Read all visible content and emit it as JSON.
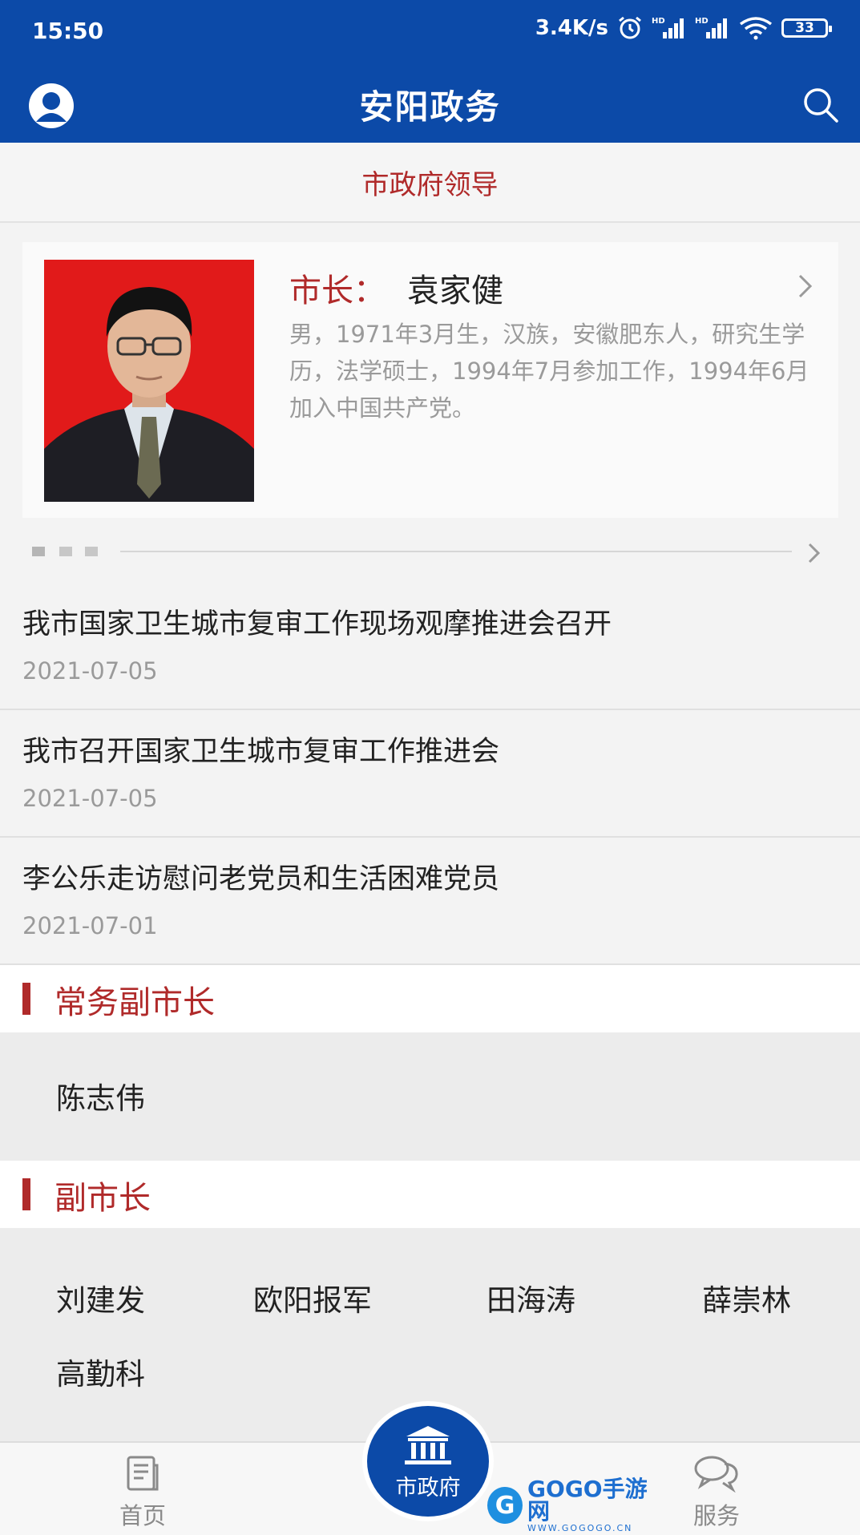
{
  "status_bar": {
    "time": "15:50",
    "network_speed": "3.4K/s",
    "battery": "33",
    "icons": [
      "alarm-icon",
      "signal-hd-icon",
      "signal-hd-icon",
      "wifi-icon",
      "battery-icon"
    ]
  },
  "header": {
    "title": "安阳政务",
    "avatar_icon": "user-avatar-icon",
    "search_icon": "search-icon",
    "accent_color": "#0c4aa8"
  },
  "section": {
    "title": "市政府领导"
  },
  "leader_card": {
    "role": "市长：",
    "name": "袁家健",
    "bio": "男，1971年3月生，汉族，安徽肥东人，研究生学历，法学硕士，1994年7月参加工作，1994年6月加入中国共产党。"
  },
  "news": [
    {
      "title": "我市国家卫生城市复审工作现场观摩推进会召开",
      "date": "2021-07-05"
    },
    {
      "title": "我市召开国家卫生城市复审工作推进会",
      "date": "2021-07-05"
    },
    {
      "title": "李公乐走访慰问老党员和生活困难党员",
      "date": "2021-07-01"
    }
  ],
  "categories": [
    {
      "label": "常务副市长",
      "people": [
        "陈志伟"
      ]
    },
    {
      "label": "副市长",
      "people": [
        "刘建发",
        "欧阳报军",
        "田海涛",
        "薛崇林",
        "高勤科"
      ]
    }
  ],
  "tabbar": {
    "home": "首页",
    "center": "市政府",
    "service": "服务"
  },
  "watermark": {
    "brand": "GOGO手游网",
    "sub": "WWW.GOGOGO.CN"
  }
}
